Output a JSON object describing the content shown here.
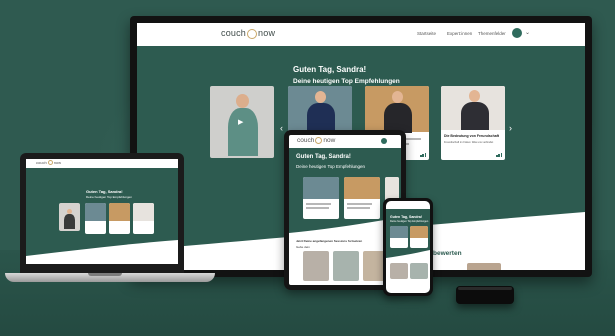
{
  "brand": {
    "logo_left": "couch",
    "logo_right": "now"
  },
  "tv": {
    "nav_links": [
      "Startseite",
      "Expert:innen",
      "Themenfelder"
    ],
    "greeting": "Guten Tag, Sandra!",
    "subheading": "Deine heutigen Top Empfehlungen",
    "featured_card": {
      "title": "Die Bedeutung von Freundschaft",
      "description": "Freundschaft im Fokus: Was uns verbindet"
    },
    "partial_section_title": "bewerten"
  },
  "tablet": {
    "greeting": "Guten Tag, Sandra!",
    "subheading": "Deine heutigen Top Empfehlungen",
    "lower_section_title": "Jetzt Deine angefangenen Sessions fortsetzen",
    "lower_section_sub": "Gebe dein"
  },
  "laptop": {
    "greeting": "Guten Tag, Sandra!",
    "subheading": "Deine heutigen Top Empfehlungen"
  },
  "phone": {
    "greeting": "Guten Tag, Sandra!",
    "subheading": "Deine heutigen Top Empfehlungen"
  },
  "colors": {
    "brand_green": "#2d5b50",
    "accent_gold": "#c9a86a",
    "background": "#2f5a50"
  },
  "icons": [
    "play-icon",
    "chevron-left-icon",
    "chevron-right-icon",
    "avatar-icon",
    "chevron-down-icon",
    "bars-icon"
  ]
}
